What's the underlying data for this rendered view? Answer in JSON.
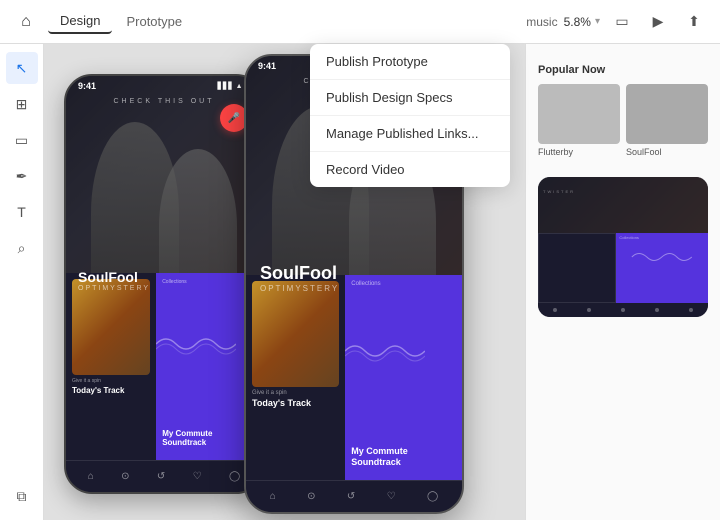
{
  "toolbar": {
    "home_icon": "⌂",
    "tabs": [
      {
        "label": "Design",
        "active": true
      },
      {
        "label": "Prototype",
        "active": false
      }
    ],
    "project_name": "music",
    "zoom": "5.8%",
    "device_icon": "▭",
    "play_icon": "▶",
    "share_icon": "⬆"
  },
  "tools": [
    {
      "name": "cursor",
      "icon": "↖",
      "active": true
    },
    {
      "name": "frame",
      "icon": "⊞"
    },
    {
      "name": "rectangle",
      "icon": "▭"
    },
    {
      "name": "pen",
      "icon": "✒"
    },
    {
      "name": "text",
      "icon": "T"
    },
    {
      "name": "zoom",
      "icon": "⌕"
    },
    {
      "name": "layers",
      "icon": "⧉"
    }
  ],
  "dropdown": {
    "items": [
      {
        "label": "Publish Prototype"
      },
      {
        "label": "Publish Design Specs"
      },
      {
        "label": "Manage Published Links..."
      },
      {
        "label": "Record Video"
      }
    ]
  },
  "phone_left": {
    "status_time": "9:41",
    "app_title": "CHECK THIS OUT",
    "song_name": "SoulFool",
    "song_artist": "OPTIMYSTERY",
    "card_left_label": "Give it a spin",
    "today_track": "Today's Track",
    "card_right_label": "Collections",
    "commute": "My Commute Soundtrack"
  },
  "phone_center": {
    "status_time": "9:41",
    "app_title": "CHECK THIS OUT",
    "song_name": "SoulFool",
    "song_artist": "OPTIMYSTERY",
    "card_left_label": "Give it a spin",
    "today_track": "Today's Track",
    "card_right_label": "Collections",
    "commute": "My Commute Soundtrack"
  },
  "right_panel": {
    "popular_title": "Popular Now",
    "items": [
      {
        "name": "Flutterby"
      },
      {
        "name": "SoulFool"
      }
    ],
    "mini_card_labels": [
      "TWISTER",
      "Collections"
    ]
  }
}
